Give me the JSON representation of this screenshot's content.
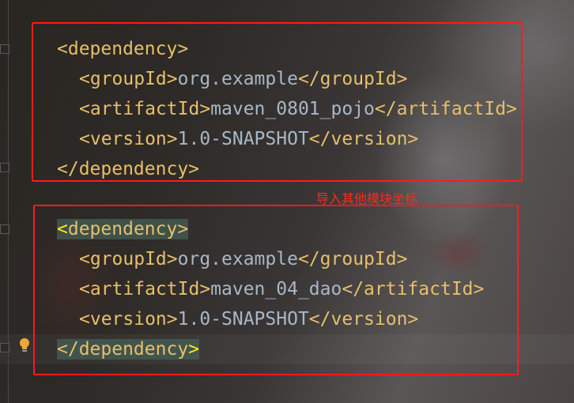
{
  "block1": {
    "open": "<dependency>",
    "groupId_open": "<groupId>",
    "groupId": "org.example",
    "groupId_close": "</groupId>",
    "artifactId_open": "<artifactId>",
    "artifactId": "maven_0801_pojo",
    "artifactId_close": "</artifactId>",
    "version_open": "<version>",
    "version": "1.0-SNAPSHOT",
    "version_close": "</version>",
    "close": "</dependency>"
  },
  "annotation": "导入其他模块坐标",
  "block2": {
    "open_lt": "<",
    "open": "dependency>",
    "groupId_open": "<groupId>",
    "groupId": "org.example",
    "groupId_close": "</groupId>",
    "artifactId_open": "<artifactId>",
    "artifactId": "maven_04_dao",
    "artifactId_close": "</artifactId>",
    "version_open": "<version>",
    "version": "1.0-SNAPSHOT",
    "version_close": "</version>",
    "close": "</dependency",
    "close_gt": ">"
  },
  "colors": {
    "tag": "#e8bf6a",
    "value": "#a9b7c6",
    "box": "#ff1a1a",
    "match_brace": "#fcea1a"
  }
}
